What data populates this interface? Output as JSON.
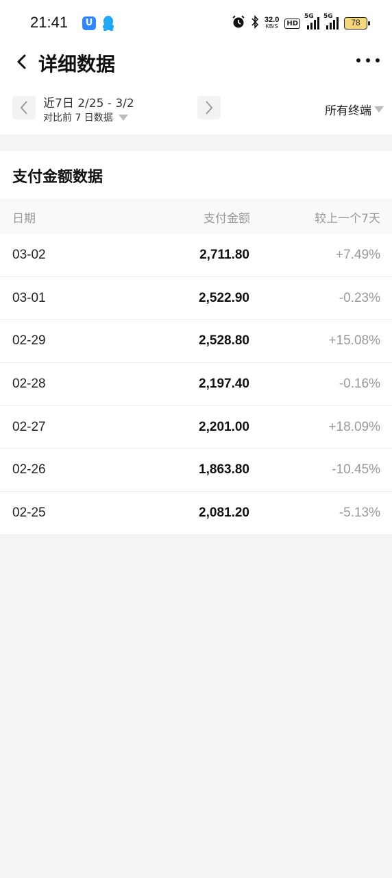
{
  "status_bar": {
    "time": "21:41",
    "net_speed_value": "32.0",
    "net_speed_unit": "KB/S",
    "hd_label": "HD",
    "signal1_label": "5G",
    "signal2_label": "5G",
    "battery": "78",
    "icons": [
      "app-u-icon",
      "qq-icon",
      "alarm-icon",
      "bluetooth-icon",
      "signal-icon",
      "battery-icon"
    ]
  },
  "nav": {
    "title": "详细数据"
  },
  "filter": {
    "date_range": "近7日 2/25 - 3/2",
    "compare": "对比前 7 日数据",
    "terminal": "所有终端"
  },
  "section": {
    "title": "支付金额数据",
    "columns": [
      "日期",
      "支付金额",
      "较上一个7天"
    ],
    "rows": [
      {
        "date": "03-02",
        "amount": "2,711.80",
        "change": "+7.49%"
      },
      {
        "date": "03-01",
        "amount": "2,522.90",
        "change": "-0.23%"
      },
      {
        "date": "02-29",
        "amount": "2,528.80",
        "change": "+15.08%"
      },
      {
        "date": "02-28",
        "amount": "2,197.40",
        "change": "-0.16%"
      },
      {
        "date": "02-27",
        "amount": "2,201.00",
        "change": "+18.09%"
      },
      {
        "date": "02-26",
        "amount": "1,863.80",
        "change": "-10.45%"
      },
      {
        "date": "02-25",
        "amount": "2,081.20",
        "change": "-5.13%"
      }
    ]
  }
}
